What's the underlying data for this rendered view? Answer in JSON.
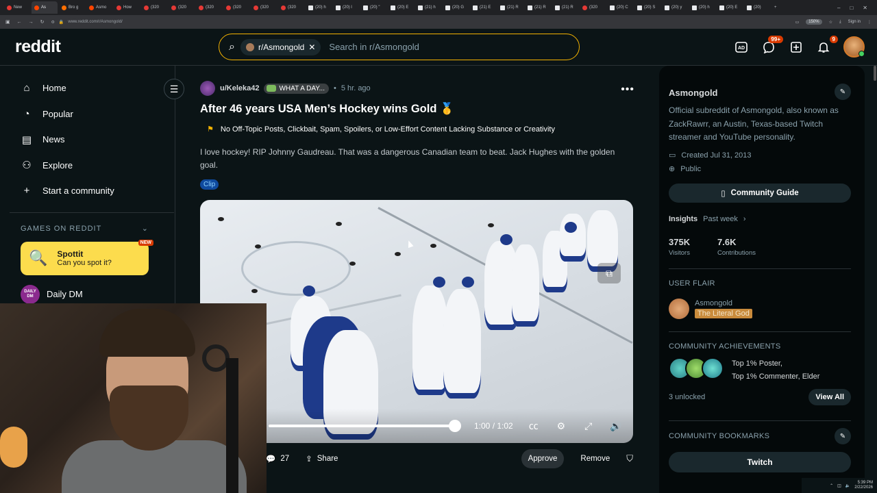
{
  "browser": {
    "tabs": [
      {
        "label": "New",
        "icon": "youtube"
      },
      {
        "label": "As",
        "icon": "reddit",
        "active": true
      },
      {
        "label": "Bro g",
        "icon": "brave"
      },
      {
        "label": "Asmo",
        "icon": "reddit"
      },
      {
        "label": "How",
        "icon": "youtube"
      },
      {
        "label": "(320",
        "icon": "youtube"
      },
      {
        "label": "(320",
        "icon": "youtube"
      },
      {
        "label": "(320",
        "icon": "youtube"
      },
      {
        "label": "(320",
        "icon": "youtube"
      },
      {
        "label": "(320",
        "icon": "youtube"
      },
      {
        "label": "(320",
        "icon": "youtube"
      },
      {
        "label": "(20) h",
        "icon": "x"
      },
      {
        "label": "(20) l",
        "icon": "x"
      },
      {
        "label": "(20) \"",
        "icon": "x"
      },
      {
        "label": "(20) E",
        "icon": "x"
      },
      {
        "label": "(21) h",
        "icon": "x"
      },
      {
        "label": "(20) G",
        "icon": "x"
      },
      {
        "label": "(21) E",
        "icon": "x"
      },
      {
        "label": "(21) R",
        "icon": "x"
      },
      {
        "label": "(21) R",
        "icon": "x"
      },
      {
        "label": "(21) R",
        "icon": "x"
      },
      {
        "label": "(320",
        "icon": "youtube"
      },
      {
        "label": "(20) C",
        "icon": "x"
      },
      {
        "label": "(20) S",
        "icon": "x"
      },
      {
        "label": "(20) y",
        "icon": "x"
      },
      {
        "label": "(20) h",
        "icon": "x"
      },
      {
        "label": "(20) E",
        "icon": "x"
      },
      {
        "label": "(20)",
        "icon": "x"
      }
    ],
    "new_tab": "+",
    "url": "www.reddit.com/r/Asmongold/",
    "zoom": "150%",
    "sign_in": "Sign in"
  },
  "header": {
    "logo": "reddit",
    "search_chip": "r/Asmongold",
    "search_placeholder": "Search in r/Asmongold",
    "chat_badge": "99+",
    "notif_badge": "9"
  },
  "sidebar": {
    "items": [
      {
        "label": "Home",
        "icon": "home-icon"
      },
      {
        "label": "Popular",
        "icon": "popular-icon"
      },
      {
        "label": "News",
        "icon": "news-icon"
      },
      {
        "label": "Explore",
        "icon": "explore-icon"
      },
      {
        "label": "Start a community",
        "icon": "plus-icon"
      }
    ],
    "games_heading": "GAMES ON REDDIT",
    "game": {
      "title": "Spottit",
      "subtitle": "Can you spot it?",
      "badge": "NEW"
    },
    "daily": {
      "label": "Daily DM",
      "icon_text": "DAILY DM"
    }
  },
  "post": {
    "author": "u/Keleka42",
    "flair": "WHAT A DAY...",
    "separator": "•",
    "time": "5 hr. ago",
    "title": "After 46 years USA Men’s Hockey wins Gold 🥇",
    "rule": "No Off-Topic Posts, Clickbait, Spam, Spoilers, or Low-Effort Content Lacking Substance or Creativity",
    "body": "I love hockey! RIP Johnny Gaudreau. That was a dangerous Canadian team to beat. Jack Hughes with the golden goal.",
    "tag": "Clip",
    "video": {
      "time": "1:00 / 1:02",
      "progress": 0.97
    },
    "comments": "27",
    "share": "Share",
    "approve": "Approve",
    "remove": "Remove"
  },
  "right": {
    "name": "Asmongold",
    "description": "Official subreddit of Asmongold, also known as ZackRawrr, an Austin, Texas-based Twitch streamer and YouTube personality.",
    "created": "Created Jul 31, 2013",
    "visibility": "Public",
    "guide": "Community Guide",
    "insights": "Insights",
    "period": "Past week",
    "visitors_n": "375K",
    "visitors_l": "Visitors",
    "contrib_n": "7.6K",
    "contrib_l": "Contributions",
    "user_flair_head": "USER FLAIR",
    "flair_user": "Asmongold",
    "flair_tag": "The Literal God",
    "ach_head": "COMMUNITY ACHIEVEMENTS",
    "ach_1": "Top 1% Poster,",
    "ach_2": "Top 1% Commenter, Elder",
    "unlocked": "3 unlocked",
    "view_all": "View All",
    "bookmarks_head": "COMMUNITY BOOKMARKS",
    "twitch": "Twitch"
  },
  "tray": {
    "time": "5:39 PM",
    "date": "2/22/2026"
  }
}
